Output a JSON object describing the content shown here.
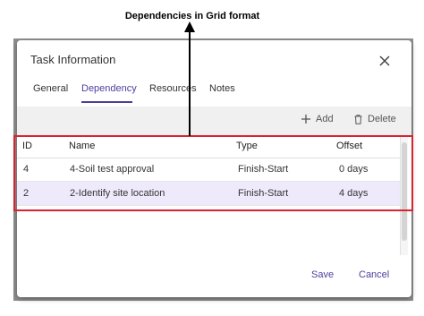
{
  "annotation": {
    "text": "Dependencies in Grid format"
  },
  "dialog": {
    "title": "Task Information",
    "tabs": [
      {
        "label": "General",
        "active": false
      },
      {
        "label": "Dependency",
        "active": true
      },
      {
        "label": "Resources",
        "active": false
      },
      {
        "label": "Notes",
        "active": false
      }
    ],
    "toolbar": {
      "add_label": "Add",
      "delete_label": "Delete"
    },
    "grid": {
      "columns": [
        "ID",
        "Name",
        "Type",
        "Offset"
      ],
      "rows": [
        {
          "id": "4",
          "name": "4-Soil test approval",
          "type": "Finish-Start",
          "offset": "0 days",
          "selected": false
        },
        {
          "id": "2",
          "name": "2-Identify site location",
          "type": "Finish-Start",
          "offset": "4 days",
          "selected": true
        }
      ]
    },
    "footer": {
      "save_label": "Save",
      "cancel_label": "Cancel"
    }
  },
  "colors": {
    "accent": "#4b3f9e",
    "highlight": "#d9232f",
    "selected_row": "#eeeafb"
  }
}
